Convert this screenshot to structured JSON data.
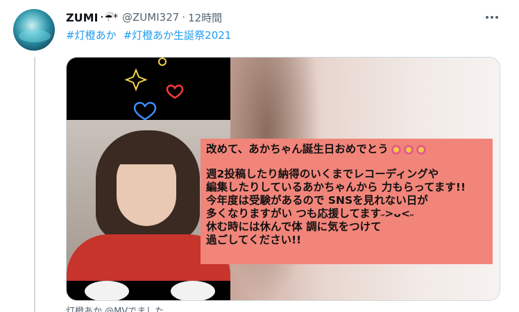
{
  "tweet": {
    "display_name": "ZUMI",
    "name_emoji": "･☔*",
    "handle": "@ZUMI327",
    "separator": "·",
    "timestamp": "12時間",
    "hashtags": [
      "#灯橙あか",
      "#灯橙あか生誕祭2021"
    ]
  },
  "image_message": {
    "line1": "改めて、あかちゃん誕生日おめでとう",
    "line2": "週2投稿したり納得のいくまでレコーディングや",
    "line3": "編集したりしているあかちゃんから 力もらってます!!",
    "line4": "今年度は受験があるので SNSを見れない日が",
    "line5": "多くなりますがい つも応援してます˶>ᴗ<˶",
    "line6": "休む時には休んで体 調に気をつけて",
    "line7": "過ごしてください!!"
  },
  "next_tweet_preview": "灯橙あか @MVでました",
  "colors": {
    "link": "#1d9bf0",
    "secondary_text": "#536471",
    "message_bg": "#f2857a"
  },
  "icons": {
    "more": "more-horizontal-icon",
    "sparkle": "sparkle-icon",
    "heart_red": "heart-icon",
    "heart_blue": "heart-icon"
  }
}
